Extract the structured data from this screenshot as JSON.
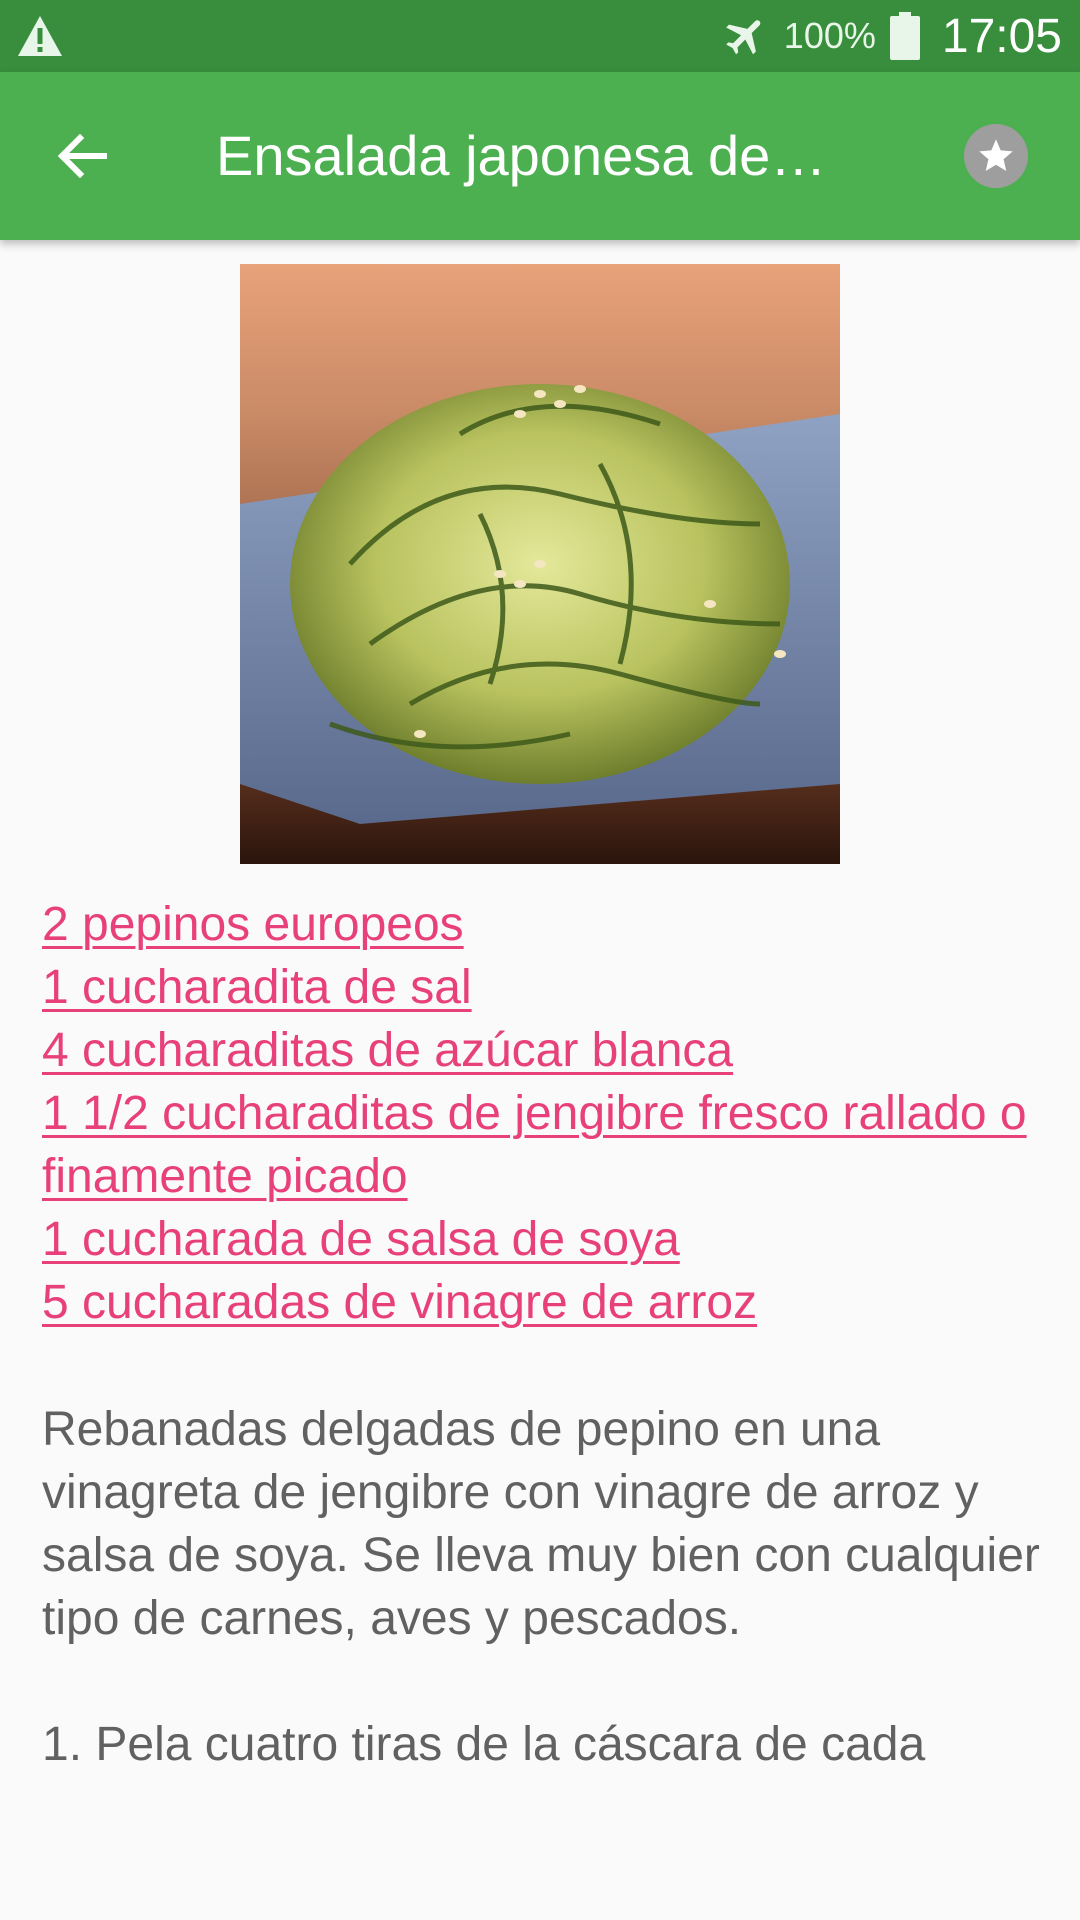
{
  "status_bar": {
    "battery_percent": "100%",
    "time": "17:05",
    "icons": [
      "warning-icon",
      "airplane-mode-icon",
      "battery-icon"
    ]
  },
  "app_bar": {
    "title": "Ensalada japonesa de…",
    "icons": [
      "back-arrow-icon",
      "star-icon"
    ]
  },
  "ingredients": [
    "2 pepinos europeos",
    "1 cucharadita de sal",
    "4 cucharaditas de azúcar blanca",
    "1 1/2 cucharaditas de jengibre fresco rallado o finamente picado",
    "1 cucharada de salsa de soya",
    "5 cucharadas de vinagre de arroz"
  ],
  "description": "Rebanadas delgadas de pepino en una vinagreta de jengibre con vinagre de arroz y salsa de soya. Se lleva muy bien con cualquier tipo de carnes, aves y pescados.",
  "step_1": "1. Pela cuatro tiras de la cáscara de cada",
  "colors": {
    "status_bar": "#388e3c",
    "app_bar": "#4caf50",
    "link": "#e8407a",
    "body_text": "#616161"
  }
}
